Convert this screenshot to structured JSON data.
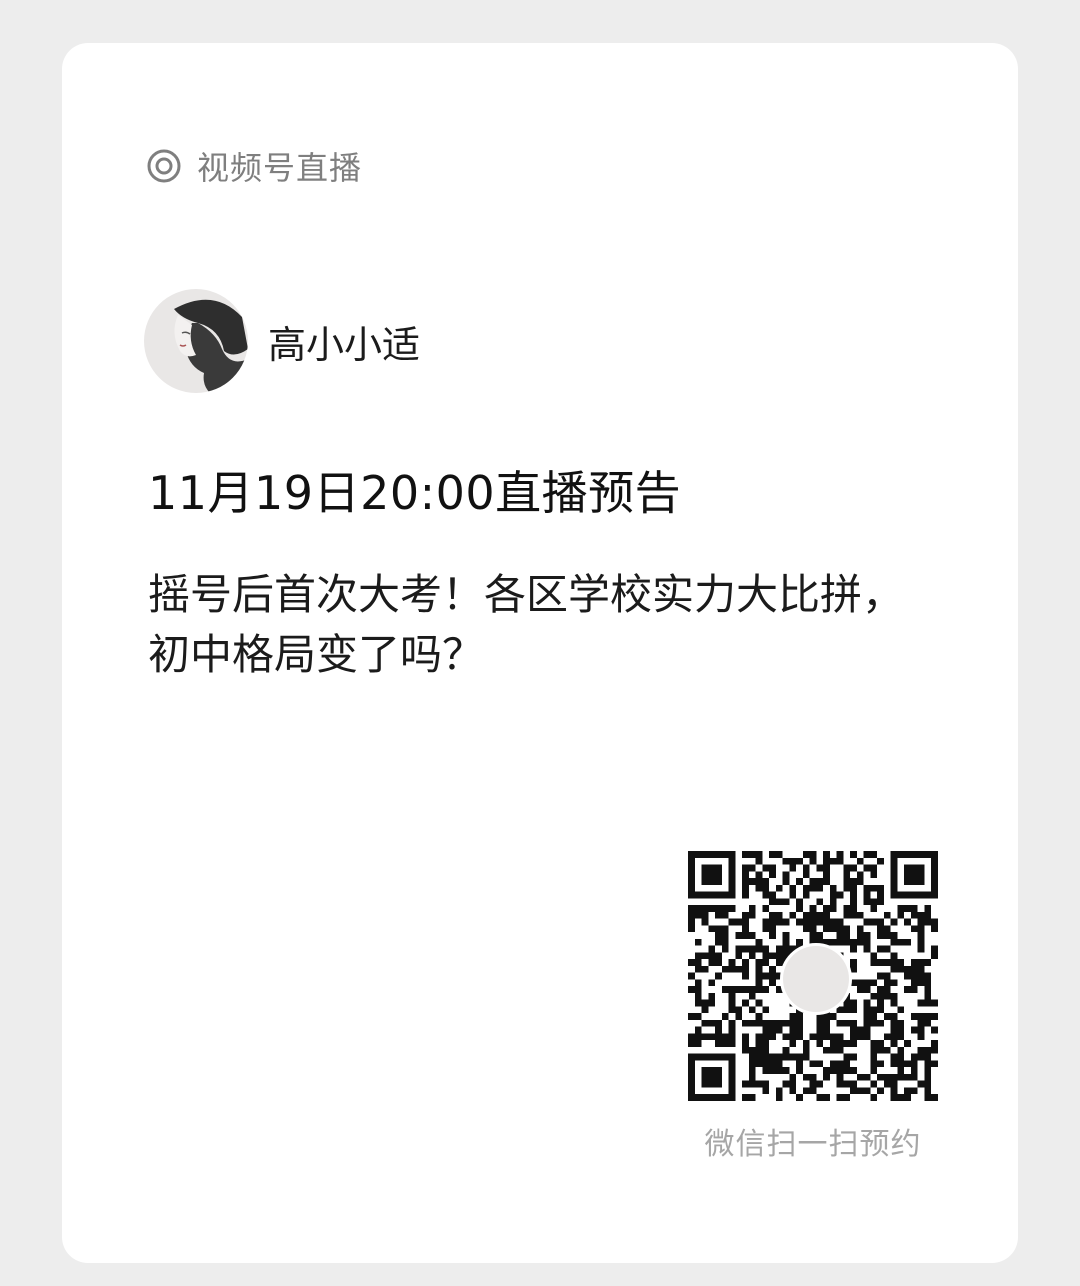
{
  "channel": {
    "icon": "channels-icon",
    "label": "视频号直播"
  },
  "author": {
    "avatar": "avatar",
    "name": "高小小适"
  },
  "live": {
    "time_title": "11月19日20:00直播预告",
    "description": "摇号后首次大考！各区学校实力大比拼，初中格局变了吗？"
  },
  "qr": {
    "icon": "qr-code",
    "caption": "微信扫一扫预约"
  },
  "colors": {
    "background": "#ededed",
    "card": "#ffffff",
    "muted_text": "#7f7f7f",
    "caption_text": "#a6a6a6",
    "primary_text": "#111111"
  }
}
